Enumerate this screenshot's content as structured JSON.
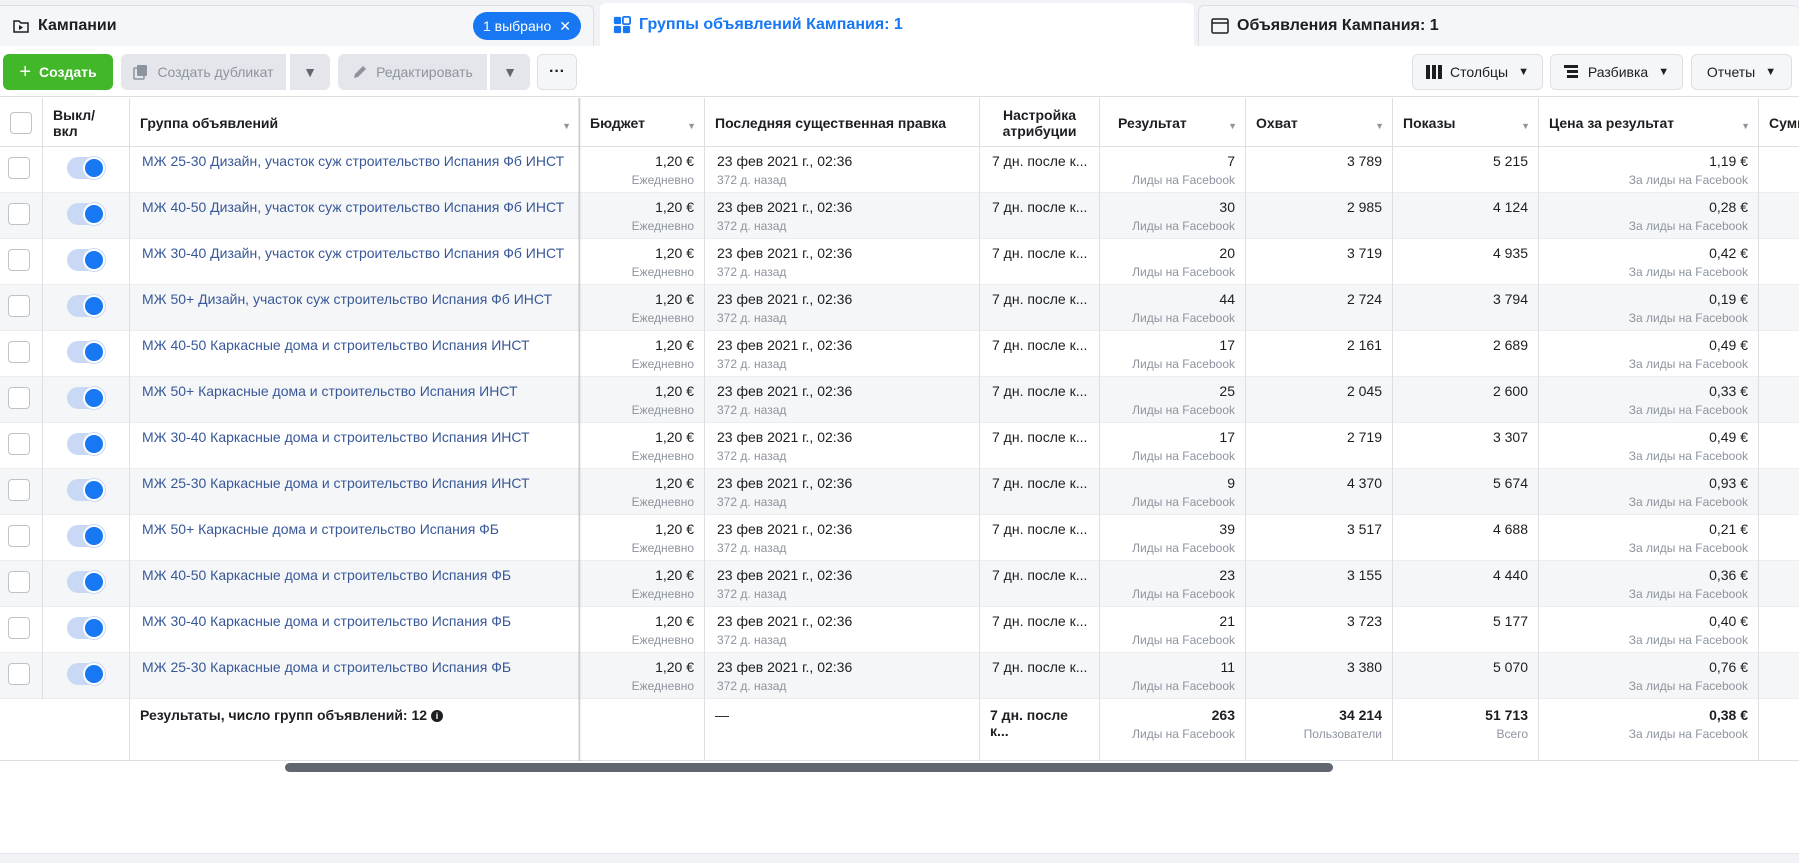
{
  "tabs": {
    "campaigns": {
      "label": "Кампании",
      "selected_pill": "1 выбрано"
    },
    "adsets": {
      "label": "Группы объявлений Кампания: 1"
    },
    "ads": {
      "label": "Объявления Кампания: 1"
    }
  },
  "toolbar": {
    "create": "Создать",
    "duplicate": "Создать дубликат",
    "edit": "Редактировать",
    "more": "···",
    "columns": "Столбцы",
    "breakdown": "Разбивка",
    "reports": "Отчеты"
  },
  "headers": {
    "onoff": "Выкл/\nвкл",
    "name": "Группа объявлений",
    "budget": "Бюджет",
    "last_edit": "Последняя существенная правка",
    "attribution": "Настройка атрибуции",
    "result": "Результат",
    "reach": "Охват",
    "impressions": "Показы",
    "cost": "Цена за результат",
    "spent": "Сумм"
  },
  "rows": [
    {
      "name": "МЖ 25-30 Дизайн, участок суж строительство Испания Фб ИНСТ",
      "budget": "1,20 €",
      "budget_type": "Ежедневно",
      "date": "23 фев 2021 г., 02:36",
      "ago": "372 д. назад",
      "attr": "7 дн. после к...",
      "result": "7",
      "result_type": "Лиды на Facebook",
      "reach": "3 789",
      "impr": "5 215",
      "cost": "1,19 €",
      "cost_type": "За лиды на Facebook"
    },
    {
      "name": "МЖ 40-50 Дизайн, участок суж строительство Испания Фб ИНСТ",
      "budget": "1,20 €",
      "budget_type": "Ежедневно",
      "date": "23 фев 2021 г., 02:36",
      "ago": "372 д. назад",
      "attr": "7 дн. после к...",
      "result": "30",
      "result_type": "Лиды на Facebook",
      "reach": "2 985",
      "impr": "4 124",
      "cost": "0,28 €",
      "cost_type": "За лиды на Facebook"
    },
    {
      "name": "МЖ 30-40 Дизайн, участок суж строительство Испания Фб ИНСТ",
      "budget": "1,20 €",
      "budget_type": "Ежедневно",
      "date": "23 фев 2021 г., 02:36",
      "ago": "372 д. назад",
      "attr": "7 дн. после к...",
      "result": "20",
      "result_type": "Лиды на Facebook",
      "reach": "3 719",
      "impr": "4 935",
      "cost": "0,42 €",
      "cost_type": "За лиды на Facebook"
    },
    {
      "name": "МЖ 50+ Дизайн, участок суж строительство Испания Фб ИНСТ",
      "budget": "1,20 €",
      "budget_type": "Ежедневно",
      "date": "23 фев 2021 г., 02:36",
      "ago": "372 д. назад",
      "attr": "7 дн. после к...",
      "result": "44",
      "result_type": "Лиды на Facebook",
      "reach": "2 724",
      "impr": "3 794",
      "cost": "0,19 €",
      "cost_type": "За лиды на Facebook"
    },
    {
      "name": "МЖ 40-50 Каркасные дома и строительство Испания ИНСТ",
      "budget": "1,20 €",
      "budget_type": "Ежедневно",
      "date": "23 фев 2021 г., 02:36",
      "ago": "372 д. назад",
      "attr": "7 дн. после к...",
      "result": "17",
      "result_type": "Лиды на Facebook",
      "reach": "2 161",
      "impr": "2 689",
      "cost": "0,49 €",
      "cost_type": "За лиды на Facebook"
    },
    {
      "name": "МЖ 50+ Каркасные дома и строительство Испания ИНСТ",
      "budget": "1,20 €",
      "budget_type": "Ежедневно",
      "date": "23 фев 2021 г., 02:36",
      "ago": "372 д. назад",
      "attr": "7 дн. после к...",
      "result": "25",
      "result_type": "Лиды на Facebook",
      "reach": "2 045",
      "impr": "2 600",
      "cost": "0,33 €",
      "cost_type": "За лиды на Facebook"
    },
    {
      "name": "МЖ 30-40 Каркасные дома и строительство Испания ИНСТ",
      "budget": "1,20 €",
      "budget_type": "Ежедневно",
      "date": "23 фев 2021 г., 02:36",
      "ago": "372 д. назад",
      "attr": "7 дн. после к...",
      "result": "17",
      "result_type": "Лиды на Facebook",
      "reach": "2 719",
      "impr": "3 307",
      "cost": "0,49 €",
      "cost_type": "За лиды на Facebook"
    },
    {
      "name": "МЖ 25-30 Каркасные дома и строительство Испания ИНСТ",
      "budget": "1,20 €",
      "budget_type": "Ежедневно",
      "date": "23 фев 2021 г., 02:36",
      "ago": "372 д. назад",
      "attr": "7 дн. после к...",
      "result": "9",
      "result_type": "Лиды на Facebook",
      "reach": "4 370",
      "impr": "5 674",
      "cost": "0,93 €",
      "cost_type": "За лиды на Facebook"
    },
    {
      "name": "МЖ 50+ Каркасные дома и строительство Испания ФБ",
      "budget": "1,20 €",
      "budget_type": "Ежедневно",
      "date": "23 фев 2021 г., 02:36",
      "ago": "372 д. назад",
      "attr": "7 дн. после к...",
      "result": "39",
      "result_type": "Лиды на Facebook",
      "reach": "3 517",
      "impr": "4 688",
      "cost": "0,21 €",
      "cost_type": "За лиды на Facebook"
    },
    {
      "name": "МЖ 40-50 Каркасные дома и строительство Испания ФБ",
      "budget": "1,20 €",
      "budget_type": "Ежедневно",
      "date": "23 фев 2021 г., 02:36",
      "ago": "372 д. назад",
      "attr": "7 дн. после к...",
      "result": "23",
      "result_type": "Лиды на Facebook",
      "reach": "3 155",
      "impr": "4 440",
      "cost": "0,36 €",
      "cost_type": "За лиды на Facebook"
    },
    {
      "name": "МЖ 30-40 Каркасные дома и строительство Испания ФБ",
      "budget": "1,20 €",
      "budget_type": "Ежедневно",
      "date": "23 фев 2021 г., 02:36",
      "ago": "372 д. назад",
      "attr": "7 дн. после к...",
      "result": "21",
      "result_type": "Лиды на Facebook",
      "reach": "3 723",
      "impr": "5 177",
      "cost": "0,40 €",
      "cost_type": "За лиды на Facebook"
    },
    {
      "name": "МЖ 25-30 Каркасные дома и строительство Испания ФБ",
      "budget": "1,20 €",
      "budget_type": "Ежедневно",
      "date": "23 фев 2021 г., 02:36",
      "ago": "372 д. назад",
      "attr": "7 дн. после к...",
      "result": "11",
      "result_type": "Лиды на Facebook",
      "reach": "3 380",
      "impr": "5 070",
      "cost": "0,76 €",
      "cost_type": "За лиды на Facebook"
    }
  ],
  "totals": {
    "label": "Результаты, число групп объявлений: 12",
    "last_edit": "—",
    "attr": "7 дн. после к...",
    "result": "263",
    "result_type": "Лиды на Facebook",
    "reach": "34 214",
    "reach_type": "Пользователи",
    "impr": "51 713",
    "impr_type": "Всего",
    "cost": "0,38 €",
    "cost_type": "За лиды на Facebook"
  },
  "colors": {
    "accent": "#1877f2",
    "create": "#42b72a",
    "link": "#385898"
  }
}
